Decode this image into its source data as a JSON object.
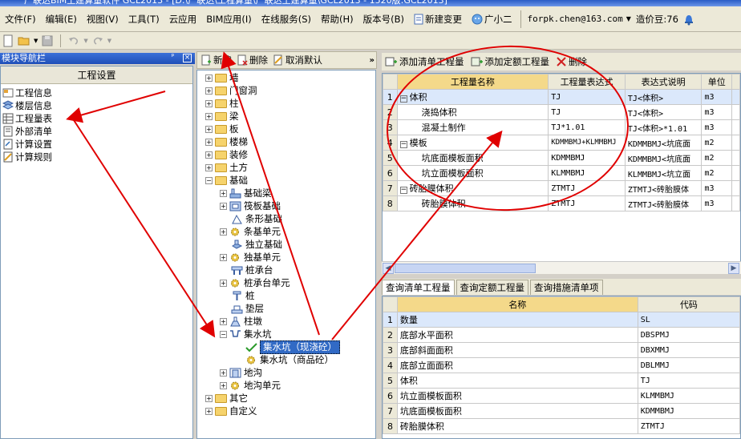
{
  "window": {
    "title": "广联达BIM土建算量软件 GCL2013 - [D:\\广联达\\工程算量\\广联达土建算量\\GCL2013 - 1520版:GCL2013]"
  },
  "menu": {
    "items": [
      "文件(F)",
      "编辑(E)",
      "视图(V)",
      "工具(T)",
      "云应用",
      "BIM应用(I)",
      "在线服务(S)",
      "帮助(H)",
      "版本号(B)"
    ],
    "new_change": "新建变更",
    "assistant": "广小二",
    "account": "forpk.chen@163.com",
    "beans": "造价豆:76"
  },
  "nav": {
    "title": "模块导航栏",
    "section": "工程设置",
    "items": [
      "工程信息",
      "楼层信息",
      "工程量表",
      "外部清单",
      "计算设置",
      "计算规则"
    ]
  },
  "tree": {
    "toolbar": {
      "new": "新建",
      "delete": "删除",
      "cancel_default": "取消默认"
    },
    "top_nodes": [
      "墙",
      "门窗洞",
      "柱",
      "梁",
      "板",
      "楼梯",
      "装修",
      "土方",
      "基础"
    ],
    "foundation_children": [
      "基础梁",
      "筏板基础",
      "条形基础",
      "条基单元",
      "独立基础",
      "独基单元",
      "桩承台",
      "桩承台单元",
      "桩",
      "垫层",
      "柱墩",
      "集水坑"
    ],
    "pit_children": [
      "集水坑（现浇砼）",
      "集水坑（商品砼）"
    ],
    "foundation_tail": [
      "地沟",
      "地沟单元"
    ],
    "bottom_nodes": [
      "其它",
      "自定义"
    ]
  },
  "quantity_table": {
    "toolbar": {
      "add_list": "添加清单工程量",
      "add_quota": "添加定额工程量",
      "delete": "删除"
    },
    "headers": [
      "工程量名称",
      "工程量表达式",
      "表达式说明",
      "单位"
    ],
    "rows": [
      {
        "num": "1",
        "name": "体积",
        "expr": "TJ",
        "desc": "TJ<体积>",
        "unit": "m3"
      },
      {
        "num": "2",
        "name": "浇捣体积",
        "expr": "TJ",
        "desc": "TJ<体积>",
        "unit": "m3"
      },
      {
        "num": "3",
        "name": "混凝土制作",
        "expr": "TJ*1.01",
        "desc": "TJ<体积>*1.01",
        "unit": "m3"
      },
      {
        "num": "4",
        "name": "模板",
        "expr": "KDMMBMJ+KLMMBMJ",
        "desc": "KDMMBMJ<坑底面",
        "unit": "m2"
      },
      {
        "num": "5",
        "name": "坑底面模板面积",
        "expr": "KDMMBMJ",
        "desc": "KDMMBMJ<坑底面",
        "unit": "m2"
      },
      {
        "num": "6",
        "name": "坑立面模板面积",
        "expr": "KLMMBMJ",
        "desc": "KLMMBMJ<坑立面",
        "unit": "m2"
      },
      {
        "num": "7",
        "name": "砖胎膜体积",
        "expr": "ZTMTJ",
        "desc": "ZTMTJ<砖胎膜体",
        "unit": "m3"
      },
      {
        "num": "8",
        "name": "砖胎膜体积",
        "expr": "ZTMTJ",
        "desc": "ZTMTJ<砖胎膜体",
        "unit": "m3"
      }
    ]
  },
  "query": {
    "tabs": [
      "查询清单工程量",
      "查询定额工程量",
      "查询措施清单项"
    ],
    "headers": [
      "名称",
      "代码"
    ],
    "rows": [
      {
        "num": "1",
        "name": "数量",
        "code": "SL"
      },
      {
        "num": "2",
        "name": "底部水平面积",
        "code": "DBSPMJ"
      },
      {
        "num": "3",
        "name": "底部斜面面积",
        "code": "DBXMMJ"
      },
      {
        "num": "4",
        "name": "底部立面面积",
        "code": "DBLMMJ"
      },
      {
        "num": "5",
        "name": "体积",
        "code": "TJ"
      },
      {
        "num": "6",
        "name": "坑立面模板面积",
        "code": "KLMMBMJ"
      },
      {
        "num": "7",
        "name": "坑底面模板面积",
        "code": "KDMMBMJ"
      },
      {
        "num": "8",
        "name": "砖胎膜体积",
        "code": "ZTMTJ"
      }
    ]
  },
  "colors": {
    "annotation": "#e00000",
    "selection": "#316ac5",
    "highlight_header": "#f4d98a"
  }
}
